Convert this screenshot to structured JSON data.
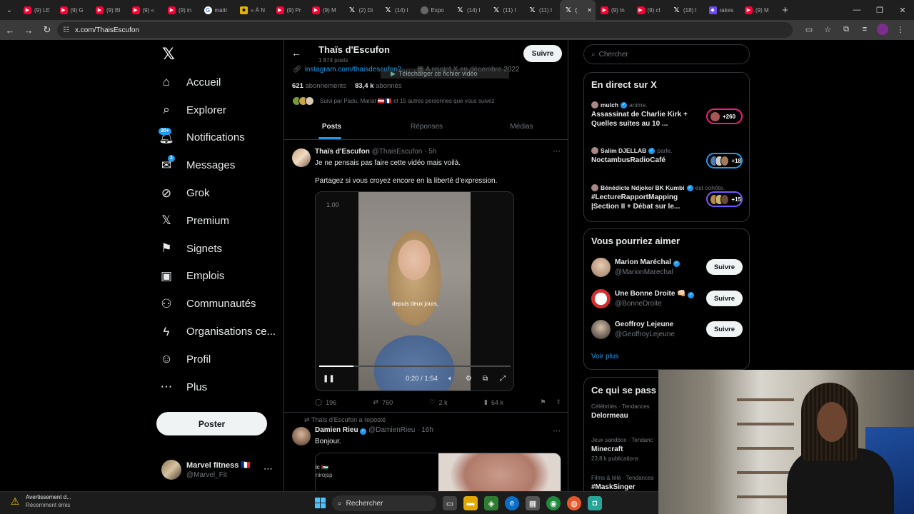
{
  "browser": {
    "tabs": [
      {
        "label": "(9) LE",
        "icon": "yt"
      },
      {
        "label": "(9) G",
        "icon": "yt"
      },
      {
        "label": "(9) Bl",
        "icon": "yt"
      },
      {
        "label": "(9) «",
        "icon": "yt"
      },
      {
        "label": "(9) in",
        "icon": "yt"
      },
      {
        "label": "maitr",
        "icon": "g"
      },
      {
        "label": "« À N",
        "icon": "t"
      },
      {
        "label": "(9) Pr",
        "icon": "yt"
      },
      {
        "label": "(9) M",
        "icon": "yt"
      },
      {
        "label": "(2) Di",
        "icon": "x"
      },
      {
        "label": "(14) I",
        "icon": "x"
      },
      {
        "label": "Expo",
        "icon": "gr"
      },
      {
        "label": "(14) I",
        "icon": "x"
      },
      {
        "label": "(11) I",
        "icon": "x"
      },
      {
        "label": "(11) I",
        "icon": "x"
      },
      {
        "label": "(",
        "icon": "x",
        "active": true
      },
      {
        "label": "(9) In",
        "icon": "yt"
      },
      {
        "label": "(9) cl",
        "icon": "yt"
      },
      {
        "label": "(18) I",
        "icon": "x"
      },
      {
        "label": "rakes",
        "icon": "p"
      },
      {
        "label": "(9) M",
        "icon": "yt"
      }
    ],
    "url": "x.com/ThaisEscufon"
  },
  "nav": {
    "items": [
      {
        "label": "Accueil",
        "icon": "home-icon",
        "glyph": "⌂"
      },
      {
        "label": "Explorer",
        "icon": "search-icon",
        "glyph": "⌕"
      },
      {
        "label": "Notifications",
        "icon": "bell-icon",
        "glyph": "🔔︎",
        "badge": "20+"
      },
      {
        "label": "Messages",
        "icon": "mail-icon",
        "glyph": "✉",
        "badge": "1"
      },
      {
        "label": "Grok",
        "icon": "grok-icon",
        "glyph": "⊘"
      },
      {
        "label": "Premium",
        "icon": "x-logo-icon",
        "glyph": "𝕏"
      },
      {
        "label": "Signets",
        "icon": "bookmark-icon",
        "glyph": "⚑"
      },
      {
        "label": "Emplois",
        "icon": "briefcase-icon",
        "glyph": "▣"
      },
      {
        "label": "Communautés",
        "icon": "people-icon",
        "glyph": "⚇"
      },
      {
        "label": "Organisations ce...",
        "icon": "lightning-icon",
        "glyph": "ϟ"
      },
      {
        "label": "Profil",
        "icon": "person-icon",
        "glyph": "☺"
      },
      {
        "label": "Plus",
        "icon": "more-circle-icon",
        "glyph": "⋯"
      }
    ],
    "post_label": "Poster",
    "me": {
      "name": "Marvel fitness 🇫🇷",
      "handle": "@Marvel_Fit"
    }
  },
  "profile": {
    "name": "Thaïs d'Escufon",
    "posts_count": "1 874 posts",
    "follow_label": "Suivre",
    "link": "instagram.com/thaisdescufon?...",
    "joined": "A rejoint X en décembre 2022",
    "download_overlay": "Télécharger ce fichier vidéo",
    "following_count": "621",
    "following_label": "abonnements",
    "followers_count": "83,4 k",
    "followers_label": "abonnés",
    "followed_by": "Suivi par Padu, Manat 🇦🇹🇫🇷 et 15 autres personnes que vous suivez",
    "tabs": [
      "Posts",
      "Réponses",
      "Médias"
    ]
  },
  "tweet1": {
    "name": "Thaïs d'Escufon",
    "handle": "@ThaisEscufon",
    "time": "· 5h",
    "text1": "Je ne pensais pas faire cette vidéo mais voilà.",
    "text2": "Partagez si vous croyez encore en la liberté d'expression.",
    "video": {
      "speed": "1.00",
      "caption": "depuis deux jours,",
      "time": "0:20 / 1:54",
      "progress": 0.18
    },
    "replies": "196",
    "reposts": "760",
    "likes": "2 k",
    "views": "64 k"
  },
  "tweet2": {
    "repost_line": "Thaïs d'Escufon a reposté",
    "name": "Damien Rieu",
    "handle": "@DamienRieu",
    "time": "· 16h",
    "text": "Bonjour.",
    "media_text1": "ic 🇵🇸",
    "media_text2": "nirojsp"
  },
  "right": {
    "search_placeholder": "Chercher",
    "live_title": "En direct sur X",
    "live": [
      {
        "host": "mulch",
        "action": "anime.",
        "title": "Assassinat de Charlie Kirk + Quelles suites au 10 ...",
        "count": "+260",
        "ring": "red"
      },
      {
        "host": "Salim DJELLAB",
        "action": "parle.",
        "title": "NoctambusRadioCafé",
        "count": "+18",
        "ring": "blue"
      },
      {
        "host": "Bénédicte Ndjoko/ BK Kumbi",
        "action": "est cohôte.",
        "title": "#LectureRapportMapping |Section II + Débat sur le...",
        "count": "+15",
        "ring": "purple"
      }
    ],
    "wtf_title": "Vous pourriez aimer",
    "wtf": [
      {
        "name": "Marion Maréchal",
        "handle": "@MarionMarechal",
        "follow": "Suivre"
      },
      {
        "name": "Une Bonne Droite 👊🏻",
        "handle": "@BonneDroite",
        "follow": "Suivre"
      },
      {
        "name": "Geoffroy Lejeune",
        "handle": "@GeoffroyLejeune",
        "follow": "Suivre"
      }
    ],
    "see_more": "Voir plus",
    "trends_title": "Ce qui se pass",
    "trends": [
      {
        "category": "Célébrités · Tendances",
        "title": "Delormeau",
        "count": ""
      },
      {
        "category": "Jeux sandbox · Tendanc",
        "title": "Minecraft",
        "count": "23,8 k publications"
      },
      {
        "category": "Films & télé · Tendances",
        "title": "#MaskSinger",
        "count": ""
      }
    ]
  },
  "taskbar": {
    "notif_title": "Avertissement d...",
    "notif_sub": "Récemment émis",
    "search_label": "Rechercher"
  }
}
